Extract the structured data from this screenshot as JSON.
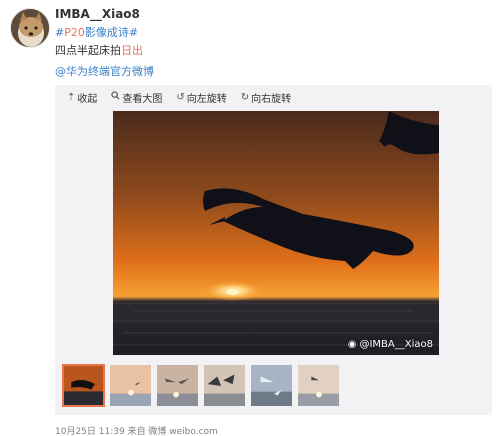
{
  "post": {
    "username": "IMBA__Xiao8",
    "topic_prefix": "#",
    "topic_highlight": "P20",
    "topic_suffix": "影像成诗#",
    "text_main": "四点半起床拍",
    "text_highlight": "日出",
    "mention": "@华为终端官方微博",
    "meta": "10月25日 11:39 来自 微博 weibo.com"
  },
  "toolbar": {
    "collapse": "收起",
    "view_large": "查看大图",
    "rotate_left": "向左旋转",
    "rotate_right": "向右旋转"
  },
  "photo": {
    "watermark": "@IMBA__Xiao8"
  },
  "thumbnails": [
    {
      "name": "thumb-1",
      "active": true
    },
    {
      "name": "thumb-2",
      "active": false
    },
    {
      "name": "thumb-3",
      "active": false
    },
    {
      "name": "thumb-4",
      "active": false
    },
    {
      "name": "thumb-5",
      "active": false
    },
    {
      "name": "thumb-6",
      "active": false
    }
  ],
  "colors": {
    "link": "#3a80c6",
    "highlight": "#eb7350",
    "panel_bg": "#f2f2f5",
    "meta_text": "#808080"
  }
}
